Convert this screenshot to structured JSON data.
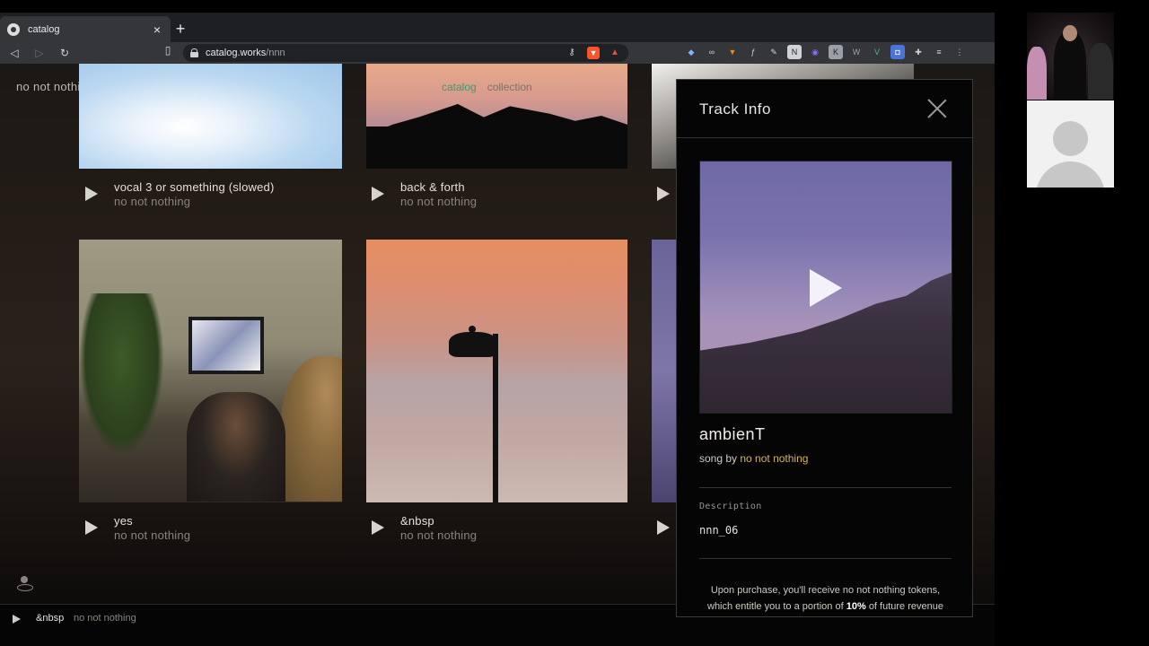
{
  "browser": {
    "tab_title": "catalog",
    "url_host": "catalog.works",
    "url_path": "/nnn"
  },
  "page": {
    "artist_header": "no not nothing",
    "nav": {
      "catalog": "catalog",
      "collection": "collection"
    },
    "cards": [
      {
        "title": "vocal 3 or something (slowed)",
        "artist": "no not nothing"
      },
      {
        "title": "back & forth",
        "artist": "no not nothing"
      },
      {
        "title": "yes",
        "artist": "no not nothing"
      },
      {
        "title": "&nbsp",
        "artist": "no not nothing"
      }
    ]
  },
  "modal": {
    "title": "Track Info",
    "track_name": "ambienT",
    "song_by": "song by",
    "artist": "no not nothing",
    "description_label": "Description",
    "description_value": "nnn_06",
    "purchase_1": "Upon purchase, you'll receive no not nothing tokens,",
    "purchase_2": "which entitle you to a portion of",
    "purchase_pct": "10%",
    "purchase_3": "of future revenue"
  },
  "player": {
    "title": "&nbsp",
    "artist": "no not nothing"
  },
  "colors": {
    "accent_green": "#3d9a6e",
    "artist_link": "#d8b25a"
  }
}
